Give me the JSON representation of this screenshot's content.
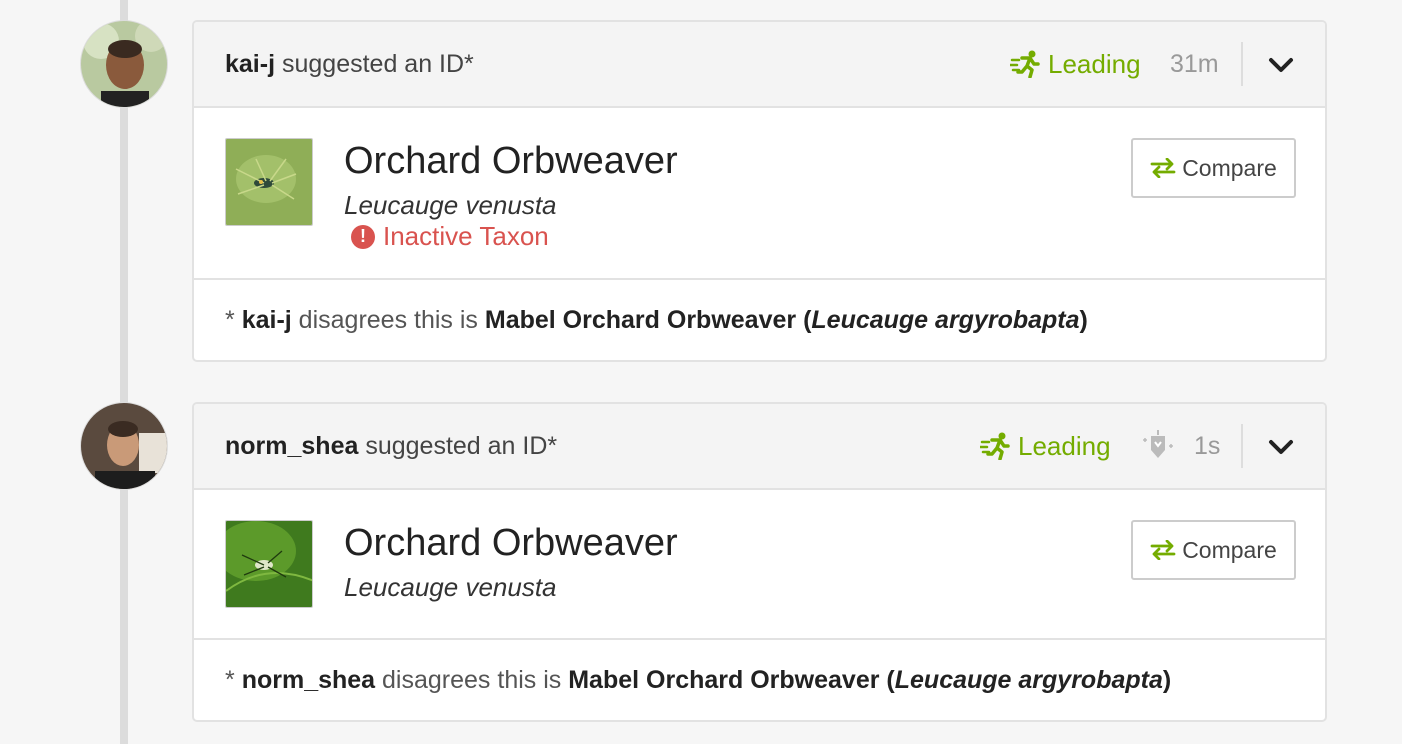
{
  "identifications": [
    {
      "user": "kai-j",
      "action": "suggested an ID*",
      "status": "Leading",
      "time": "31m",
      "common_name": "Orchard Orbweaver",
      "scientific_name": "Leucauge venusta",
      "inactive_label": "Inactive Taxon",
      "compare_label": "Compare",
      "footer": {
        "prefix": "*",
        "user": "kai-j",
        "text": "disagrees this is",
        "taxon_common": "Mabel Orchard Orbweaver",
        "taxon_sci": "Leucauge argyrobapta"
      }
    },
    {
      "user": "norm_shea",
      "action": "suggested an ID*",
      "status": "Leading",
      "time": "1s",
      "common_name": "Orchard Orbweaver",
      "scientific_name": "Leucauge venusta",
      "compare_label": "Compare",
      "footer": {
        "prefix": "*",
        "user": "norm_shea",
        "text": "disagrees this is",
        "taxon_common": "Mabel Orchard Orbweaver",
        "taxon_sci": "Leucauge argyrobapta"
      }
    }
  ],
  "colors": {
    "leading": "#74ac00",
    "inactive": "#d9534f",
    "compare_arrows": "#74ac00"
  },
  "icons": [
    "leading-runner-icon",
    "ninja-icon",
    "chevron-down-icon",
    "swap-arrows-icon",
    "exclamation-icon"
  ]
}
